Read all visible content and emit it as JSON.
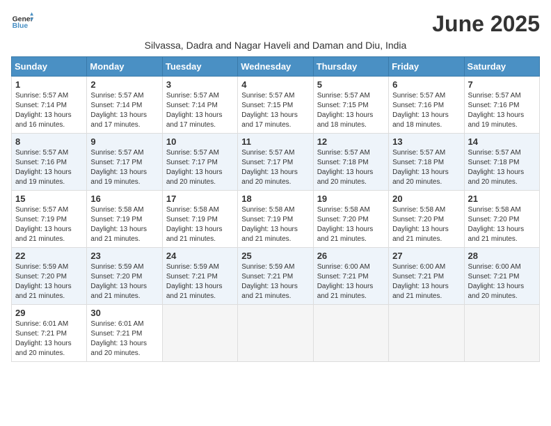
{
  "logo": {
    "line1": "General",
    "line2": "Blue"
  },
  "title": "June 2025",
  "subtitle": "Silvassa, Dadra and Nagar Haveli and Daman and Diu, India",
  "headers": [
    "Sunday",
    "Monday",
    "Tuesday",
    "Wednesday",
    "Thursday",
    "Friday",
    "Saturday"
  ],
  "weeks": [
    [
      {
        "day": "1",
        "info": "Sunrise: 5:57 AM\nSunset: 7:14 PM\nDaylight: 13 hours\nand 16 minutes."
      },
      {
        "day": "2",
        "info": "Sunrise: 5:57 AM\nSunset: 7:14 PM\nDaylight: 13 hours\nand 17 minutes."
      },
      {
        "day": "3",
        "info": "Sunrise: 5:57 AM\nSunset: 7:14 PM\nDaylight: 13 hours\nand 17 minutes."
      },
      {
        "day": "4",
        "info": "Sunrise: 5:57 AM\nSunset: 7:15 PM\nDaylight: 13 hours\nand 17 minutes."
      },
      {
        "day": "5",
        "info": "Sunrise: 5:57 AM\nSunset: 7:15 PM\nDaylight: 13 hours\nand 18 minutes."
      },
      {
        "day": "6",
        "info": "Sunrise: 5:57 AM\nSunset: 7:16 PM\nDaylight: 13 hours\nand 18 minutes."
      },
      {
        "day": "7",
        "info": "Sunrise: 5:57 AM\nSunset: 7:16 PM\nDaylight: 13 hours\nand 19 minutes."
      }
    ],
    [
      {
        "day": "8",
        "info": "Sunrise: 5:57 AM\nSunset: 7:16 PM\nDaylight: 13 hours\nand 19 minutes."
      },
      {
        "day": "9",
        "info": "Sunrise: 5:57 AM\nSunset: 7:17 PM\nDaylight: 13 hours\nand 19 minutes."
      },
      {
        "day": "10",
        "info": "Sunrise: 5:57 AM\nSunset: 7:17 PM\nDaylight: 13 hours\nand 20 minutes."
      },
      {
        "day": "11",
        "info": "Sunrise: 5:57 AM\nSunset: 7:17 PM\nDaylight: 13 hours\nand 20 minutes."
      },
      {
        "day": "12",
        "info": "Sunrise: 5:57 AM\nSunset: 7:18 PM\nDaylight: 13 hours\nand 20 minutes."
      },
      {
        "day": "13",
        "info": "Sunrise: 5:57 AM\nSunset: 7:18 PM\nDaylight: 13 hours\nand 20 minutes."
      },
      {
        "day": "14",
        "info": "Sunrise: 5:57 AM\nSunset: 7:18 PM\nDaylight: 13 hours\nand 20 minutes."
      }
    ],
    [
      {
        "day": "15",
        "info": "Sunrise: 5:57 AM\nSunset: 7:19 PM\nDaylight: 13 hours\nand 21 minutes."
      },
      {
        "day": "16",
        "info": "Sunrise: 5:58 AM\nSunset: 7:19 PM\nDaylight: 13 hours\nand 21 minutes."
      },
      {
        "day": "17",
        "info": "Sunrise: 5:58 AM\nSunset: 7:19 PM\nDaylight: 13 hours\nand 21 minutes."
      },
      {
        "day": "18",
        "info": "Sunrise: 5:58 AM\nSunset: 7:19 PM\nDaylight: 13 hours\nand 21 minutes."
      },
      {
        "day": "19",
        "info": "Sunrise: 5:58 AM\nSunset: 7:20 PM\nDaylight: 13 hours\nand 21 minutes."
      },
      {
        "day": "20",
        "info": "Sunrise: 5:58 AM\nSunset: 7:20 PM\nDaylight: 13 hours\nand 21 minutes."
      },
      {
        "day": "21",
        "info": "Sunrise: 5:58 AM\nSunset: 7:20 PM\nDaylight: 13 hours\nand 21 minutes."
      }
    ],
    [
      {
        "day": "22",
        "info": "Sunrise: 5:59 AM\nSunset: 7:20 PM\nDaylight: 13 hours\nand 21 minutes."
      },
      {
        "day": "23",
        "info": "Sunrise: 5:59 AM\nSunset: 7:20 PM\nDaylight: 13 hours\nand 21 minutes."
      },
      {
        "day": "24",
        "info": "Sunrise: 5:59 AM\nSunset: 7:21 PM\nDaylight: 13 hours\nand 21 minutes."
      },
      {
        "day": "25",
        "info": "Sunrise: 5:59 AM\nSunset: 7:21 PM\nDaylight: 13 hours\nand 21 minutes."
      },
      {
        "day": "26",
        "info": "Sunrise: 6:00 AM\nSunset: 7:21 PM\nDaylight: 13 hours\nand 21 minutes."
      },
      {
        "day": "27",
        "info": "Sunrise: 6:00 AM\nSunset: 7:21 PM\nDaylight: 13 hours\nand 21 minutes."
      },
      {
        "day": "28",
        "info": "Sunrise: 6:00 AM\nSunset: 7:21 PM\nDaylight: 13 hours\nand 20 minutes."
      }
    ],
    [
      {
        "day": "29",
        "info": "Sunrise: 6:01 AM\nSunset: 7:21 PM\nDaylight: 13 hours\nand 20 minutes."
      },
      {
        "day": "30",
        "info": "Sunrise: 6:01 AM\nSunset: 7:21 PM\nDaylight: 13 hours\nand 20 minutes."
      },
      {
        "day": "",
        "info": ""
      },
      {
        "day": "",
        "info": ""
      },
      {
        "day": "",
        "info": ""
      },
      {
        "day": "",
        "info": ""
      },
      {
        "day": "",
        "info": ""
      }
    ]
  ]
}
